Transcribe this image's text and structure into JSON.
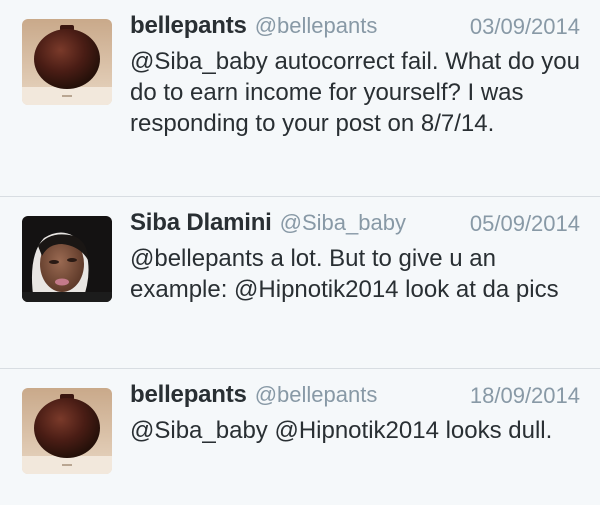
{
  "tweets": [
    {
      "name": "bellepants",
      "handle": "@bellepants",
      "date": "03/09/2014",
      "text": "@Siba_baby autocorrect fail. What do you do to earn income for yourself? I was responding to your post on 8/7/14."
    },
    {
      "name": "Siba Dlamini",
      "handle": "@Siba_baby",
      "date": "05/09/2014",
      "text": "@bellepants a lot. But to give u an example: @Hipnotik2014 look at da pics"
    },
    {
      "name": "bellepants",
      "handle": "@bellepants",
      "date": "18/09/2014",
      "text": "@Siba_baby @Hipnotik2014 looks dull."
    }
  ],
  "colors": {
    "background": "#f5f8fa",
    "text": "#292f33",
    "secondary": "#8899a6",
    "divider": "#d8dde2"
  }
}
